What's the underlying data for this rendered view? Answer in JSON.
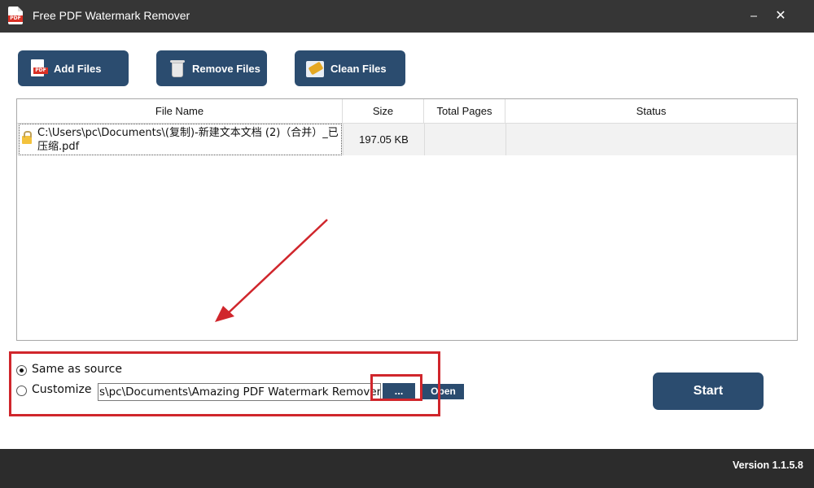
{
  "window": {
    "title": "Free PDF Watermark Remover",
    "icon": "pdf-icon",
    "controls": {
      "minimize": "⎯",
      "close": "✕"
    }
  },
  "toolbar": {
    "add_files": "Add Files",
    "remove_files": "Remove Files",
    "clean_files": "Clean Files"
  },
  "table": {
    "headers": [
      "File Name",
      "Size",
      "Total Pages",
      "Status"
    ],
    "rows": [
      {
        "file_name": "C:\\Users\\pc\\Documents\\(复制)-新建文本文档 (2)（合并）_已压缩.pdf",
        "size": "197.05 KB",
        "total_pages": "",
        "status": ""
      }
    ]
  },
  "output": {
    "same_as_source_label": "Same as source",
    "customize_label": "Customize",
    "selected": "same_as_source",
    "path_value": "s\\pc\\Documents\\Amazing PDF Watermark Remover\\",
    "browse_label": "...",
    "open_label": "Open"
  },
  "start_label": "Start",
  "footer": {
    "version": "Version 1.1.5.8"
  },
  "colors": {
    "accent": "#2b4c6f",
    "titlebar": "#363636",
    "footer": "#2c2c2c",
    "annotation": "#d0262c"
  }
}
